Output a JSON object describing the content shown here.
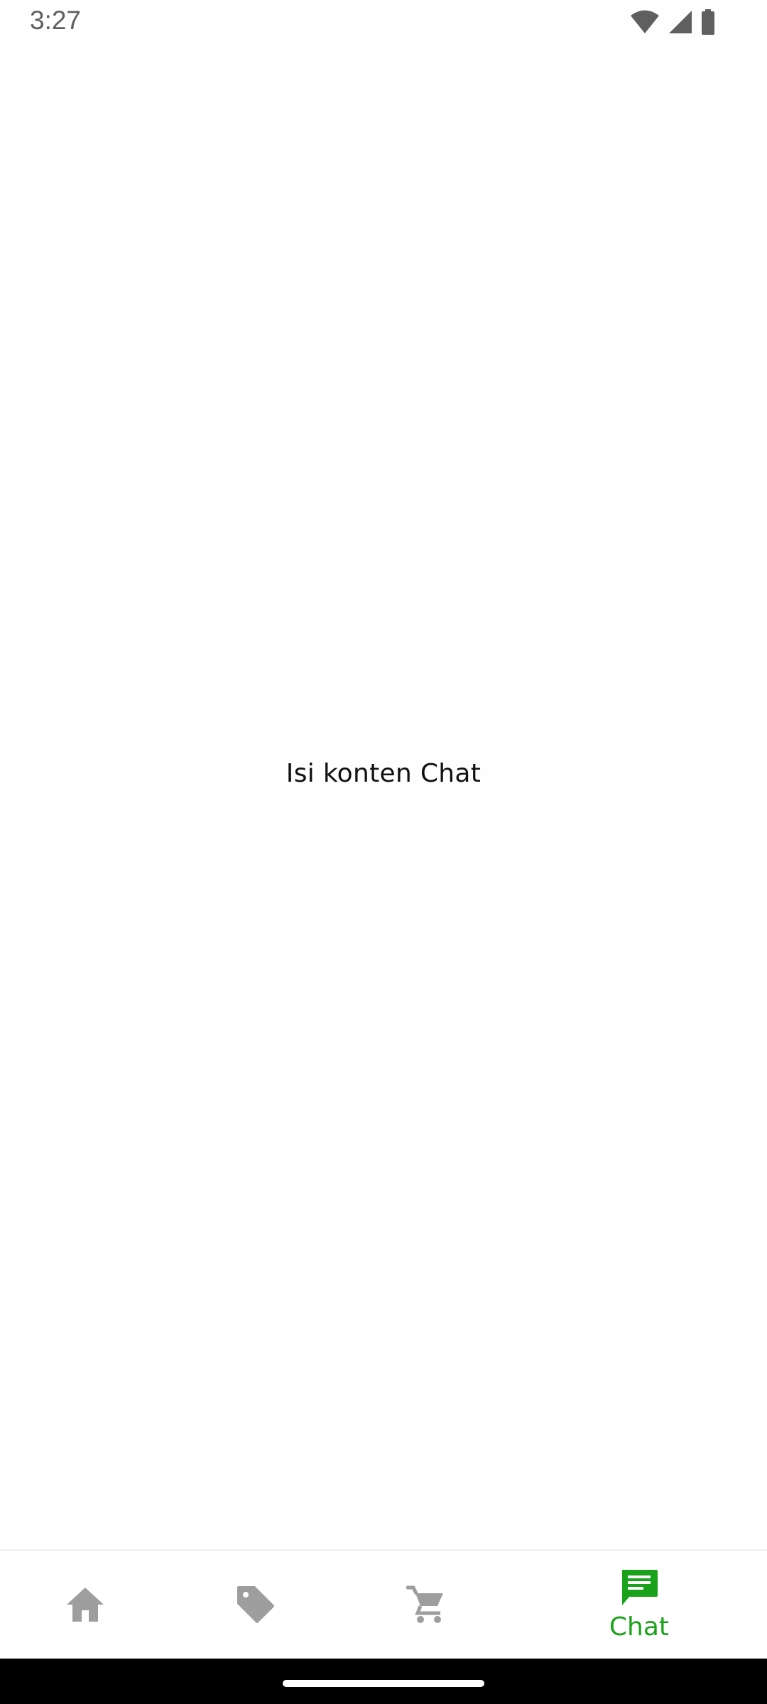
{
  "status_bar": {
    "time": "3:27",
    "icons": [
      "wifi-icon",
      "cellular-signal-icon",
      "battery-icon"
    ]
  },
  "content": {
    "text": "Isi konten Chat"
  },
  "bottom_nav": {
    "items": [
      {
        "icon": "home-icon",
        "label": "",
        "active": false
      },
      {
        "icon": "tag-icon",
        "label": "",
        "active": false
      },
      {
        "icon": "cart-icon",
        "label": "",
        "active": false
      },
      {
        "icon": "chat-icon",
        "label": "Chat",
        "active": true
      }
    ],
    "active_color": "#1aa31a",
    "inactive_color": "#9e9e9e"
  }
}
